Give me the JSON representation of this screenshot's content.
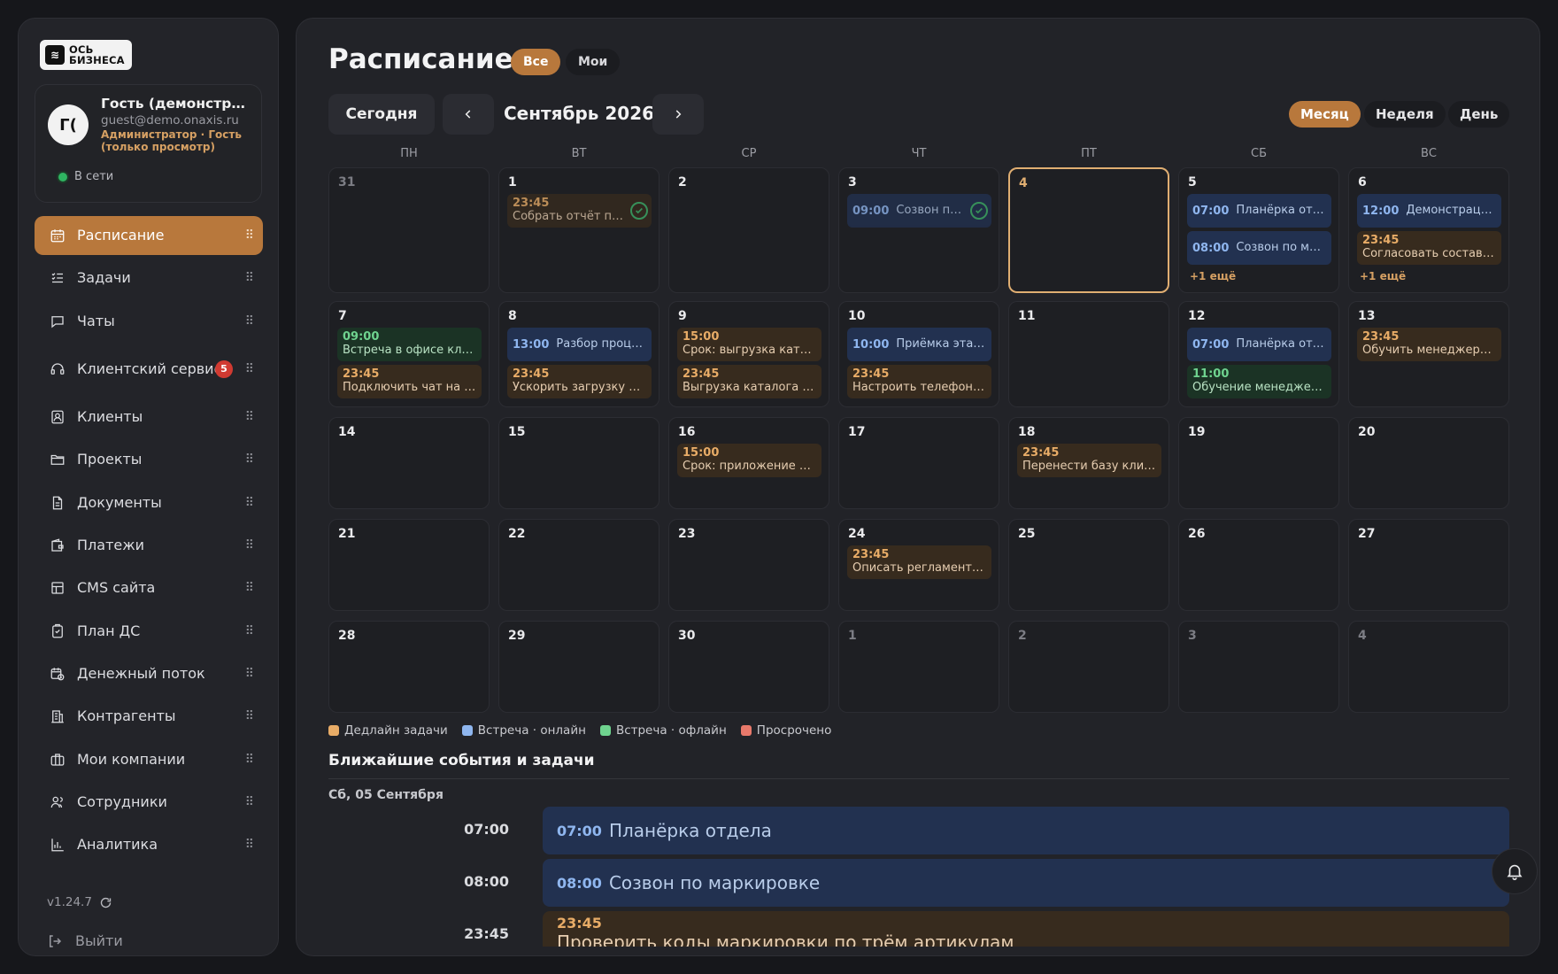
{
  "brand": {
    "logo_line1": "ОСЬ",
    "logo_line2": "БИЗНЕСА"
  },
  "user": {
    "initials": "Г(",
    "name": "Гость (демонстрация)",
    "email": "guest@demo.onaxis.ru",
    "role": "Администратор · Гость (только просмотр)",
    "status": "В сети"
  },
  "sidebar": {
    "items": [
      {
        "label": "Расписание",
        "icon": "calendar-icon",
        "active": true
      },
      {
        "label": "Задачи",
        "icon": "tasks-icon"
      },
      {
        "label": "Чаты",
        "icon": "chat-icon"
      },
      {
        "label": "Клиентский сервис",
        "icon": "headset-icon",
        "badge": "5"
      },
      {
        "label": "Клиенты",
        "icon": "contact-card-icon"
      },
      {
        "label": "Проекты",
        "icon": "folder-icon"
      },
      {
        "label": "Документы",
        "icon": "document-icon"
      },
      {
        "label": "Платежи",
        "icon": "wallet-icon"
      },
      {
        "label": "CMS сайта",
        "icon": "layout-icon"
      },
      {
        "label": "План ДС",
        "icon": "clipboard-icon"
      },
      {
        "label": "Денежный поток",
        "icon": "calendar-clock-icon"
      },
      {
        "label": "Контрагенты",
        "icon": "building-icon"
      },
      {
        "label": "Мои компании",
        "icon": "briefcase-icon"
      },
      {
        "label": "Сотрудники",
        "icon": "users-icon"
      },
      {
        "label": "Аналитика",
        "icon": "bar-chart-icon"
      }
    ],
    "version": "v1.24.7",
    "logout": "Выйти"
  },
  "page": {
    "title": "Расписание",
    "filter_all": "Все",
    "filter_mine": "Мои",
    "today_button": "Сегодня",
    "month_label": "Сентябрь 2026",
    "view_month": "Месяц",
    "view_week": "Неделя",
    "view_day": "День"
  },
  "calendar": {
    "weekdays": [
      "ПН",
      "ВТ",
      "СР",
      "ЧТ",
      "ПТ",
      "СБ",
      "ВС"
    ],
    "weeks": [
      [
        {
          "day": "31",
          "other": true,
          "events": []
        },
        {
          "day": "1",
          "events": [
            {
              "time": "23:45",
              "title": "Собрать отчёт по продажам",
              "type": "deadline",
              "done": true
            }
          ]
        },
        {
          "day": "2",
          "events": []
        },
        {
          "day": "3",
          "events": [
            {
              "time": "09:00",
              "title": "Созвон по остаткам",
              "type": "online",
              "done": true
            }
          ]
        },
        {
          "day": "4",
          "today": true,
          "events": []
        },
        {
          "day": "5",
          "events": [
            {
              "time": "07:00",
              "title": "Планёрка отдела",
              "type": "online"
            },
            {
              "time": "08:00",
              "title": "Созвон по маркировке",
              "type": "online"
            }
          ],
          "more": "+1 ещё"
        },
        {
          "day": "6",
          "events": [
            {
              "time": "12:00",
              "title": "Демонстрация личного кабинета",
              "type": "online"
            },
            {
              "time": "23:45",
              "title": "Согласовать состав поставки",
              "type": "deadline"
            }
          ],
          "more": "+1 ещё"
        }
      ],
      [
        {
          "day": "7",
          "events": [
            {
              "time": "09:00",
              "title": "Встреча в офисе клиента",
              "type": "offline"
            },
            {
              "time": "23:45",
              "title": "Подключить чат на сайте",
              "type": "deadline"
            }
          ]
        },
        {
          "day": "8",
          "events": [
            {
              "time": "13:00",
              "title": "Разбор процесса продаж",
              "type": "online"
            },
            {
              "time": "23:45",
              "title": "Ускорить загрузку каталога",
              "type": "deadline"
            }
          ]
        },
        {
          "day": "9",
          "events": [
            {
              "time": "15:00",
              "title": "Срок: выгрузка каталога",
              "type": "deadline"
            },
            {
              "time": "23:45",
              "title": "Выгрузка каталога на сайт",
              "type": "deadline"
            }
          ]
        },
        {
          "day": "10",
          "events": [
            {
              "time": "10:00",
              "title": "Приёмка этапа: чат-бот",
              "type": "online"
            },
            {
              "time": "23:45",
              "title": "Настроить телефонию",
              "type": "deadline"
            }
          ]
        },
        {
          "day": "11",
          "events": []
        },
        {
          "day": "12",
          "events": [
            {
              "time": "07:00",
              "title": "Планёрка отдела",
              "type": "online"
            },
            {
              "time": "11:00",
              "title": "Обучение менеджеров",
              "type": "offline"
            }
          ]
        },
        {
          "day": "13",
          "events": [
            {
              "time": "23:45",
              "title": "Обучить менеджеров работе в CRM",
              "type": "deadline"
            }
          ]
        }
      ],
      [
        {
          "day": "14",
          "events": []
        },
        {
          "day": "15",
          "events": []
        },
        {
          "day": "16",
          "events": [
            {
              "time": "15:00",
              "title": "Срок: приложение для курьеров",
              "type": "deadline"
            }
          ]
        },
        {
          "day": "17",
          "events": []
        },
        {
          "day": "18",
          "events": [
            {
              "time": "23:45",
              "title": "Перенести базу клиентов",
              "type": "deadline"
            }
          ]
        },
        {
          "day": "19",
          "events": []
        },
        {
          "day": "20",
          "events": []
        }
      ],
      [
        {
          "day": "21",
          "events": []
        },
        {
          "day": "22",
          "events": []
        },
        {
          "day": "23",
          "events": []
        },
        {
          "day": "24",
          "events": [
            {
              "time": "23:45",
              "title": "Описать регламент работы",
              "type": "deadline"
            }
          ]
        },
        {
          "day": "25",
          "events": []
        },
        {
          "day": "26",
          "events": []
        },
        {
          "day": "27",
          "events": []
        }
      ],
      [
        {
          "day": "28",
          "events": []
        },
        {
          "day": "29",
          "events": []
        },
        {
          "day": "30",
          "events": []
        },
        {
          "day": "1",
          "other": true,
          "events": []
        },
        {
          "day": "2",
          "other": true,
          "events": []
        },
        {
          "day": "3",
          "other": true,
          "events": []
        },
        {
          "day": "4",
          "other": true,
          "events": []
        }
      ]
    ]
  },
  "legend": [
    {
      "label": "Дедлайн задачи",
      "color": "#e8ac67"
    },
    {
      "label": "Встреча · онлайн",
      "color": "#8fb6ef"
    },
    {
      "label": "Встреча · офлайн",
      "color": "#6fd38f"
    },
    {
      "label": "Просрочено",
      "color": "#e8796b"
    }
  ],
  "upcoming": {
    "title": "Ближайшие события и задачи",
    "date": "Сб, 05 Сентября",
    "items": [
      {
        "time": "07:00",
        "title": "Планёрка отдела",
        "type": "online"
      },
      {
        "time": "08:00",
        "title": "Созвон по маркировке",
        "type": "online"
      },
      {
        "time": "23:45",
        "title": "Проверить коды маркировки по трём артикулам",
        "type": "deadline"
      }
    ]
  },
  "colors": {
    "accent": "#b8783c",
    "background": "#16171b",
    "panel": "#222328"
  }
}
